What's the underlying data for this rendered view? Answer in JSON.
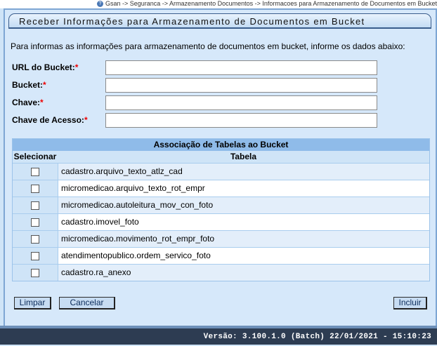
{
  "breadcrumb": {
    "text": "Gsan -> Seguranca -> Armazenamento Documentos -> Informacoes para Armazenamento de Documentos em Bucket"
  },
  "page": {
    "title": "Receber Informações para Armazenamento de Documentos em Bucket",
    "intro": "Para informas as informações para armazenamento de documentos em bucket, informe os dados abaixo:"
  },
  "form": {
    "required_mark": "*",
    "url_label": "URL do Bucket:",
    "url_value": "",
    "bucket_label": "Bucket:",
    "bucket_value": "",
    "chave_label": "Chave:",
    "chave_value": "",
    "chave_acesso_label": "Chave de Acesso:",
    "chave_acesso_value": ""
  },
  "table": {
    "caption": "Associação de Tabelas ao Bucket",
    "col_select": "Selecionar",
    "col_table": "Tabela",
    "rows": [
      {
        "name": "cadastro.arquivo_texto_atlz_cad",
        "checked": false
      },
      {
        "name": "micromedicao.arquivo_texto_rot_empr",
        "checked": false
      },
      {
        "name": "micromedicao.autoleitura_mov_con_foto",
        "checked": false
      },
      {
        "name": "cadastro.imovel_foto",
        "checked": false
      },
      {
        "name": "micromedicao.movimento_rot_empr_foto",
        "checked": false
      },
      {
        "name": "atendimentopublico.ordem_servico_foto",
        "checked": false
      },
      {
        "name": "cadastro.ra_anexo",
        "checked": false
      }
    ]
  },
  "buttons": {
    "limpar": "Limpar",
    "cancelar": "Cancelar",
    "incluir": "Incluir"
  },
  "footer": {
    "version": "Versão: 3.100.1.0 (Batch) 22/01/2021 - 15:10:23"
  },
  "colors": {
    "required": "#ee0000",
    "caption_bg": "#8fbbe9",
    "footer_bg": "#2d3c52"
  }
}
